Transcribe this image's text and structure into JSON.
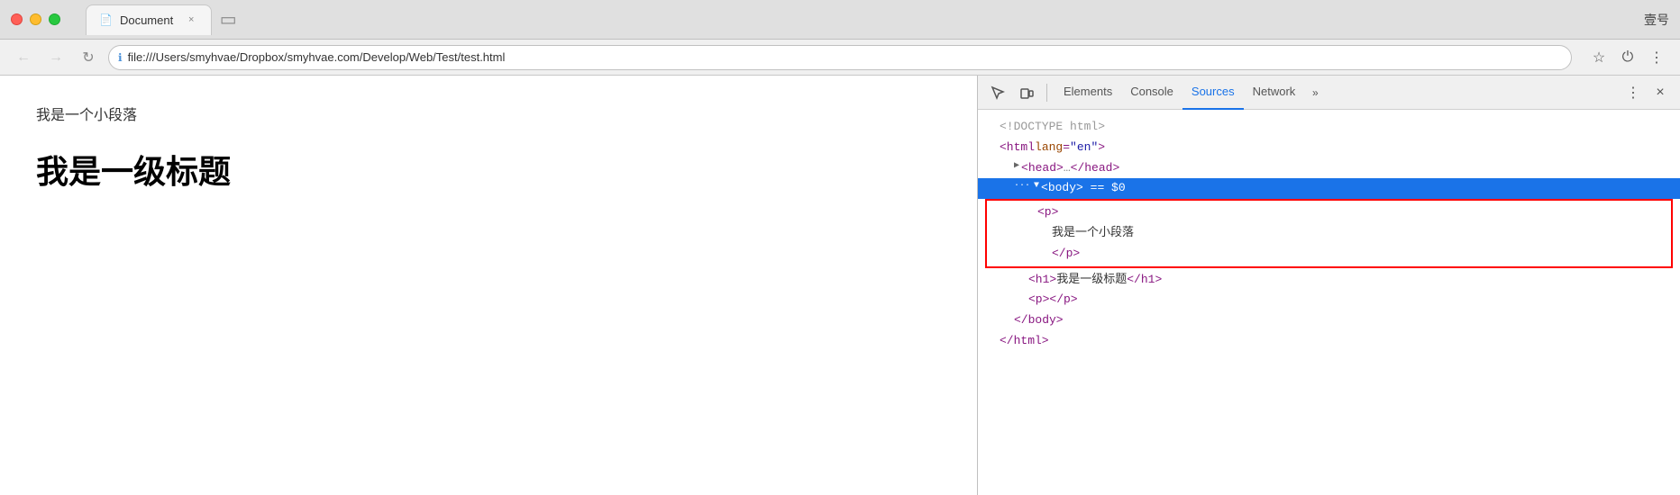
{
  "browser": {
    "title": "壹号",
    "tab": {
      "icon": "📄",
      "label": "Document",
      "close": "×"
    },
    "tab_add": "+",
    "nav": {
      "back": "←",
      "forward": "→",
      "reload": "↻",
      "url": "file:///Users/smyhvae/Dropbox/smyhvae.com/Develop/Web/Test/test.html",
      "bookmark": "☆",
      "power": "⏻",
      "menu": "⋮"
    }
  },
  "page": {
    "paragraph": "我是一个小段落",
    "heading": "我是一级标题"
  },
  "devtools": {
    "icons": {
      "cursor": "⬚",
      "device": "▭"
    },
    "tabs": [
      {
        "id": "elements",
        "label": "Elements",
        "active": true
      },
      {
        "id": "console",
        "label": "Console",
        "active": false
      },
      {
        "id": "sources",
        "label": "Sources",
        "active": false
      },
      {
        "id": "network",
        "label": "Network",
        "active": false
      }
    ],
    "more": "»",
    "right_btns": {
      "menu": "⋮",
      "close": "×"
    },
    "html": {
      "doctype": "<!DOCTYPE html>",
      "html_open": "<html lang=\"en\">",
      "head_collapsed": "▶ <head>…</head>",
      "body_selected": "▼ <body> == $0",
      "body_dots": "···",
      "p_open": "<p>",
      "p_text": "我是一个小段落",
      "p_close": "</p>",
      "h1": "<h1>我是一级标题</h1>",
      "p_empty": "<p></p>",
      "body_close": "</body>",
      "html_close": "</html>"
    }
  }
}
